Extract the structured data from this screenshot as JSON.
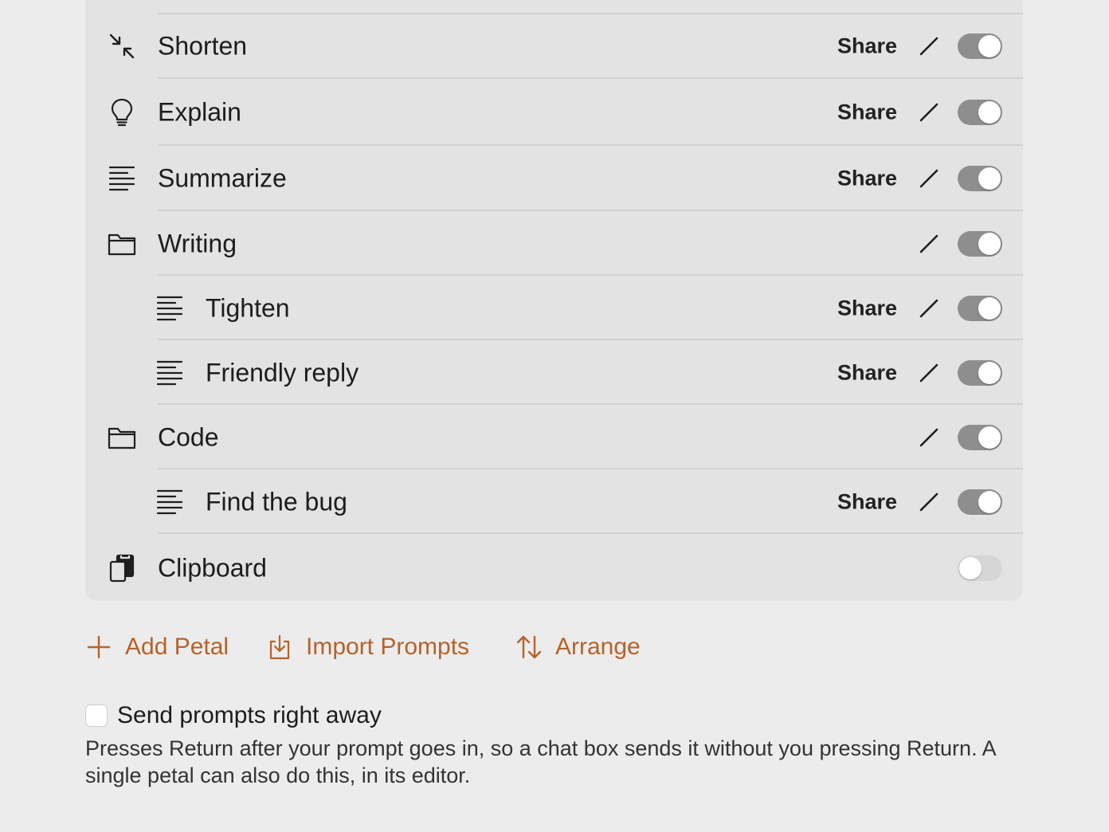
{
  "share_label": "Share",
  "rows": [
    {
      "label": "Shorten",
      "icon": "shrink-arrows-icon",
      "share": true,
      "edit": true,
      "enabled": true
    },
    {
      "label": "Explain",
      "icon": "lightbulb-icon",
      "share": true,
      "edit": true,
      "enabled": true
    },
    {
      "label": "Summarize",
      "icon": "text-lines-icon",
      "share": true,
      "edit": true,
      "enabled": true
    },
    {
      "label": "Writing",
      "icon": "folder-icon",
      "share": false,
      "edit": true,
      "enabled": true
    },
    {
      "label": "Tighten",
      "icon": "text-lines-icon",
      "share": true,
      "edit": true,
      "enabled": true
    },
    {
      "label": "Friendly reply",
      "icon": "text-lines-icon",
      "share": true,
      "edit": true,
      "enabled": true
    },
    {
      "label": "Code",
      "icon": "folder-icon",
      "share": false,
      "edit": true,
      "enabled": true
    },
    {
      "label": "Find the bug",
      "icon": "text-lines-icon",
      "share": true,
      "edit": true,
      "enabled": true
    },
    {
      "label": "Clipboard",
      "icon": "clipboard-icon",
      "share": false,
      "edit": false,
      "enabled": false
    }
  ],
  "actions": {
    "add_petal": "Add Petal",
    "import_prompts": "Import Prompts",
    "arrange": "Arrange"
  },
  "send_prompts": {
    "label": "Send prompts right away",
    "checked": false,
    "help": "Presses Return after your prompt goes in, so a chat box sends it without you pressing Return. A single petal can also do this, in its editor."
  },
  "colors": {
    "accent": "#b7622a",
    "toggle_on": "#8e8e8e",
    "toggle_off": "#d6d6d6"
  }
}
